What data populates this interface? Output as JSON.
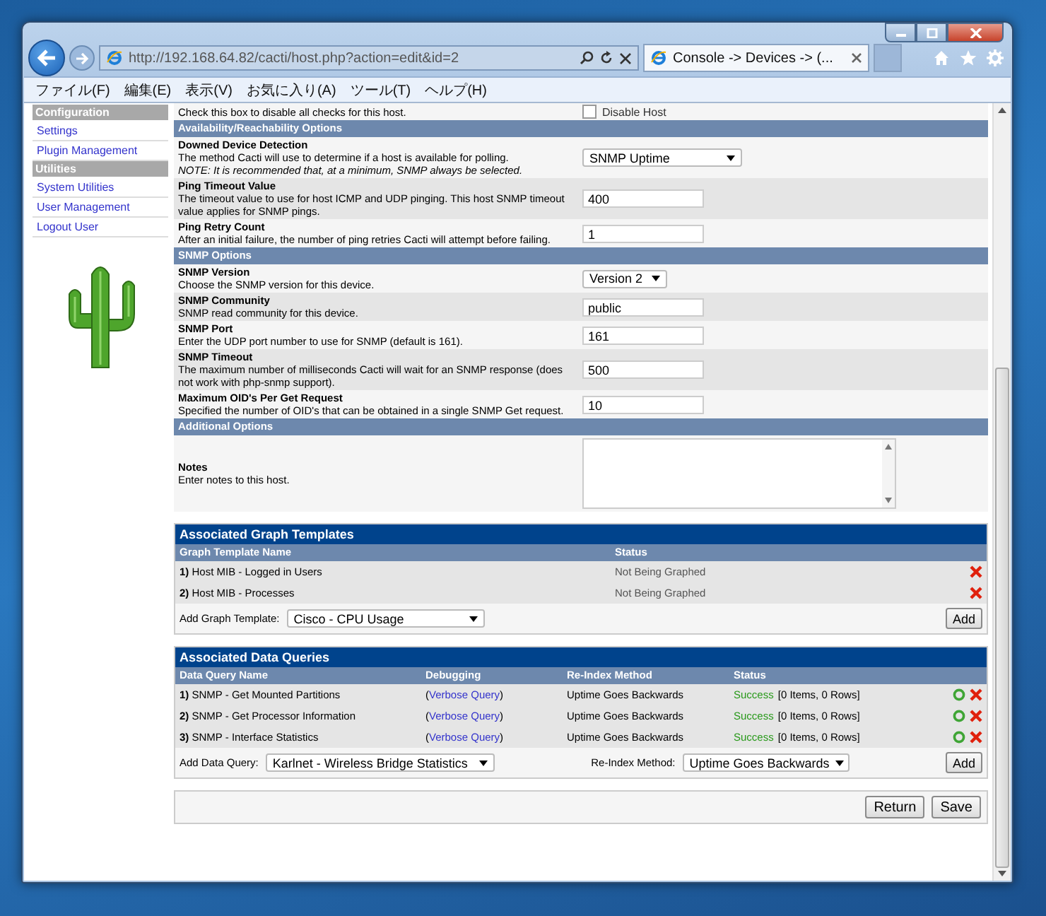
{
  "browser": {
    "url": "http://192.168.64.82/cacti/host.php?action=edit&id=2",
    "tab_title": "Console -> Devices -> (...",
    "menu": [
      "ファイル(F)",
      "編集(E)",
      "表示(V)",
      "お気に入り(A)",
      "ツール(T)",
      "ヘルプ(H)"
    ]
  },
  "sidebar": {
    "items": [
      {
        "label": "Configuration",
        "kind": "header"
      },
      {
        "label": "Settings",
        "kind": "link"
      },
      {
        "label": "Plugin Management",
        "kind": "link"
      },
      {
        "label": "Utilities",
        "kind": "header"
      },
      {
        "label": "System Utilities",
        "kind": "link"
      },
      {
        "label": "User Management",
        "kind": "link"
      },
      {
        "label": "Logout User",
        "kind": "link"
      }
    ]
  },
  "host_form": {
    "top_row": {
      "description": "Check this box to disable all checks for this host.",
      "checkbox_label": "Disable Host",
      "checked": false
    },
    "sections": [
      {
        "title": "Availability/Reachability Options",
        "fields": [
          {
            "label": "Downed Device Detection",
            "description": "The method Cacti will use to determine if a host is available for polling.",
            "note": "NOTE: It is recommended that, at a minimum, SNMP always be selected.",
            "control": {
              "kind": "select",
              "value": "SNMP Uptime"
            }
          },
          {
            "label": "Ping Timeout Value",
            "description": "The timeout value to use for host ICMP and UDP pinging. This host SNMP timeout value applies for SNMP pings.",
            "control": {
              "kind": "text",
              "value": "400"
            }
          },
          {
            "label": "Ping Retry Count",
            "description": "After an initial failure, the number of ping retries Cacti will attempt before failing.",
            "control": {
              "kind": "text",
              "value": "1"
            }
          }
        ]
      },
      {
        "title": "SNMP Options",
        "fields": [
          {
            "label": "SNMP Version",
            "description": "Choose the SNMP version for this device.",
            "control": {
              "kind": "select_small",
              "value": "Version 2"
            }
          },
          {
            "label": "SNMP Community",
            "description": "SNMP read community for this device.",
            "control": {
              "kind": "text",
              "value": "public"
            }
          },
          {
            "label": "SNMP Port",
            "description": "Enter the UDP port number to use for SNMP (default is 161).",
            "control": {
              "kind": "text",
              "value": "161"
            }
          },
          {
            "label": "SNMP Timeout",
            "description": "The maximum number of milliseconds Cacti will wait for an SNMP response (does not work with php-snmp support).",
            "control": {
              "kind": "text",
              "value": "500"
            }
          },
          {
            "label": "Maximum OID's Per Get Request",
            "description": "Specified the number of OID's that can be obtained in a single SNMP Get request.",
            "control": {
              "kind": "text",
              "value": "10"
            }
          }
        ]
      },
      {
        "title": "Additional Options",
        "fields": [
          {
            "label": "Notes",
            "description": "Enter notes to this host.",
            "control": {
              "kind": "textarea"
            }
          }
        ]
      }
    ]
  },
  "graph_templates": {
    "title": "Associated Graph Templates",
    "columns": [
      "Graph Template Name",
      "Status"
    ],
    "rows": [
      {
        "number": "1)",
        "name": "Host MIB - Logged in Users",
        "status": "Not Being Graphed"
      },
      {
        "number": "2)",
        "name": "Host MIB - Processes",
        "status": "Not Being Graphed"
      }
    ],
    "add_label": "Add Graph Template:",
    "add_select": "Cisco - CPU Usage",
    "add_button": "Add"
  },
  "data_queries": {
    "title": "Associated Data Queries",
    "columns": [
      "Data Query Name",
      "Debugging",
      "Re-Index Method",
      "Status"
    ],
    "rows": [
      {
        "number": "1)",
        "name": "SNMP - Get Mounted Partitions",
        "debug_prefix": "(",
        "debug_link": "Verbose Query",
        "debug_suffix": ")",
        "reindex": "Uptime Goes Backwards",
        "status": "Success",
        "status_detail": "[0 Items, 0 Rows]"
      },
      {
        "number": "2)",
        "name": "SNMP - Get Processor Information",
        "debug_prefix": "(",
        "debug_link": "Verbose Query",
        "debug_suffix": ")",
        "reindex": "Uptime Goes Backwards",
        "status": "Success",
        "status_detail": "[0 Items, 0 Rows]"
      },
      {
        "number": "3)",
        "name": "SNMP - Interface Statistics",
        "debug_prefix": "(",
        "debug_link": "Verbose Query",
        "debug_suffix": ")",
        "reindex": "Uptime Goes Backwards",
        "status": "Success",
        "status_detail": "[0 Items, 0 Rows]"
      }
    ],
    "add_label": "Add Data Query:",
    "add_select": "Karlnet - Wireless Bridge Statistics",
    "reindex_label": "Re-Index Method:",
    "reindex_select": "Uptime Goes Backwards",
    "add_button": "Add"
  },
  "buttons": [
    "Return",
    "Save"
  ]
}
